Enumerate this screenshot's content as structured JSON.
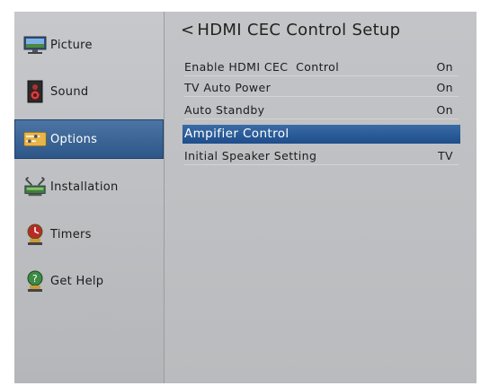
{
  "sidebar": {
    "items": [
      {
        "label": "Picture",
        "icon": "picture-icon"
      },
      {
        "label": "Sound",
        "icon": "sound-icon"
      },
      {
        "label": "Options",
        "icon": "options-icon"
      },
      {
        "label": "Installation",
        "icon": "installation-icon"
      },
      {
        "label": "Timers",
        "icon": "timers-icon"
      },
      {
        "label": "Get Help",
        "icon": "get-help-icon"
      }
    ],
    "active_index": 2
  },
  "main": {
    "back_glyph": "<",
    "title": "HDMI CEC Control Setup",
    "rows": [
      {
        "label": "Enable HDMI CEC  Control",
        "value": "On"
      },
      {
        "label": "TV Auto Power",
        "value": "On"
      },
      {
        "label": "Auto Standby",
        "value": "On"
      },
      {
        "label": "Ampifier Control",
        "value": ""
      },
      {
        "label": "Initial Speaker Setting",
        "value": "TV"
      }
    ],
    "selected_index": 3
  },
  "colors": {
    "highlight": "#2c5688",
    "panel": "#b9bbbe"
  }
}
